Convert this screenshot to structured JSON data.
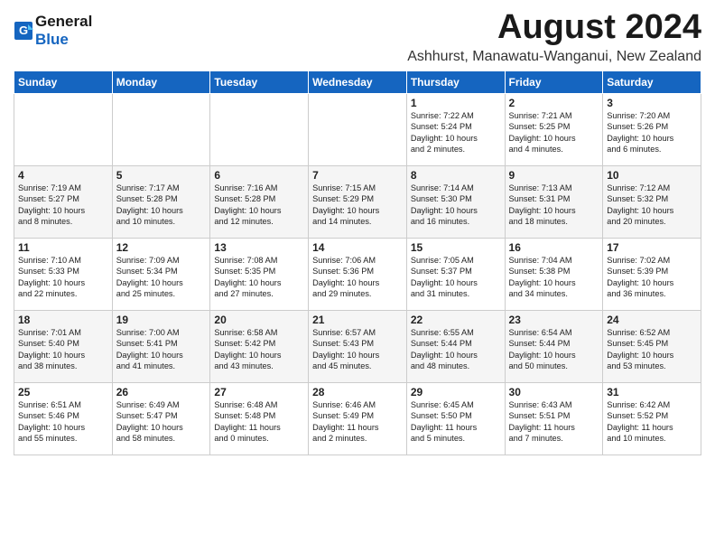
{
  "logo": {
    "general": "General",
    "blue": "Blue"
  },
  "title": "August 2024",
  "subtitle": "Ashhurst, Manawatu-Wanganui, New Zealand",
  "days_header": [
    "Sunday",
    "Monday",
    "Tuesday",
    "Wednesday",
    "Thursday",
    "Friday",
    "Saturday"
  ],
  "weeks": [
    [
      {
        "day": "",
        "info": ""
      },
      {
        "day": "",
        "info": ""
      },
      {
        "day": "",
        "info": ""
      },
      {
        "day": "",
        "info": ""
      },
      {
        "day": "1",
        "info": "Sunrise: 7:22 AM\nSunset: 5:24 PM\nDaylight: 10 hours\nand 2 minutes."
      },
      {
        "day": "2",
        "info": "Sunrise: 7:21 AM\nSunset: 5:25 PM\nDaylight: 10 hours\nand 4 minutes."
      },
      {
        "day": "3",
        "info": "Sunrise: 7:20 AM\nSunset: 5:26 PM\nDaylight: 10 hours\nand 6 minutes."
      }
    ],
    [
      {
        "day": "4",
        "info": "Sunrise: 7:19 AM\nSunset: 5:27 PM\nDaylight: 10 hours\nand 8 minutes."
      },
      {
        "day": "5",
        "info": "Sunrise: 7:17 AM\nSunset: 5:28 PM\nDaylight: 10 hours\nand 10 minutes."
      },
      {
        "day": "6",
        "info": "Sunrise: 7:16 AM\nSunset: 5:28 PM\nDaylight: 10 hours\nand 12 minutes."
      },
      {
        "day": "7",
        "info": "Sunrise: 7:15 AM\nSunset: 5:29 PM\nDaylight: 10 hours\nand 14 minutes."
      },
      {
        "day": "8",
        "info": "Sunrise: 7:14 AM\nSunset: 5:30 PM\nDaylight: 10 hours\nand 16 minutes."
      },
      {
        "day": "9",
        "info": "Sunrise: 7:13 AM\nSunset: 5:31 PM\nDaylight: 10 hours\nand 18 minutes."
      },
      {
        "day": "10",
        "info": "Sunrise: 7:12 AM\nSunset: 5:32 PM\nDaylight: 10 hours\nand 20 minutes."
      }
    ],
    [
      {
        "day": "11",
        "info": "Sunrise: 7:10 AM\nSunset: 5:33 PM\nDaylight: 10 hours\nand 22 minutes."
      },
      {
        "day": "12",
        "info": "Sunrise: 7:09 AM\nSunset: 5:34 PM\nDaylight: 10 hours\nand 25 minutes."
      },
      {
        "day": "13",
        "info": "Sunrise: 7:08 AM\nSunset: 5:35 PM\nDaylight: 10 hours\nand 27 minutes."
      },
      {
        "day": "14",
        "info": "Sunrise: 7:06 AM\nSunset: 5:36 PM\nDaylight: 10 hours\nand 29 minutes."
      },
      {
        "day": "15",
        "info": "Sunrise: 7:05 AM\nSunset: 5:37 PM\nDaylight: 10 hours\nand 31 minutes."
      },
      {
        "day": "16",
        "info": "Sunrise: 7:04 AM\nSunset: 5:38 PM\nDaylight: 10 hours\nand 34 minutes."
      },
      {
        "day": "17",
        "info": "Sunrise: 7:02 AM\nSunset: 5:39 PM\nDaylight: 10 hours\nand 36 minutes."
      }
    ],
    [
      {
        "day": "18",
        "info": "Sunrise: 7:01 AM\nSunset: 5:40 PM\nDaylight: 10 hours\nand 38 minutes."
      },
      {
        "day": "19",
        "info": "Sunrise: 7:00 AM\nSunset: 5:41 PM\nDaylight: 10 hours\nand 41 minutes."
      },
      {
        "day": "20",
        "info": "Sunrise: 6:58 AM\nSunset: 5:42 PM\nDaylight: 10 hours\nand 43 minutes."
      },
      {
        "day": "21",
        "info": "Sunrise: 6:57 AM\nSunset: 5:43 PM\nDaylight: 10 hours\nand 45 minutes."
      },
      {
        "day": "22",
        "info": "Sunrise: 6:55 AM\nSunset: 5:44 PM\nDaylight: 10 hours\nand 48 minutes."
      },
      {
        "day": "23",
        "info": "Sunrise: 6:54 AM\nSunset: 5:44 PM\nDaylight: 10 hours\nand 50 minutes."
      },
      {
        "day": "24",
        "info": "Sunrise: 6:52 AM\nSunset: 5:45 PM\nDaylight: 10 hours\nand 53 minutes."
      }
    ],
    [
      {
        "day": "25",
        "info": "Sunrise: 6:51 AM\nSunset: 5:46 PM\nDaylight: 10 hours\nand 55 minutes."
      },
      {
        "day": "26",
        "info": "Sunrise: 6:49 AM\nSunset: 5:47 PM\nDaylight: 10 hours\nand 58 minutes."
      },
      {
        "day": "27",
        "info": "Sunrise: 6:48 AM\nSunset: 5:48 PM\nDaylight: 11 hours\nand 0 minutes."
      },
      {
        "day": "28",
        "info": "Sunrise: 6:46 AM\nSunset: 5:49 PM\nDaylight: 11 hours\nand 2 minutes."
      },
      {
        "day": "29",
        "info": "Sunrise: 6:45 AM\nSunset: 5:50 PM\nDaylight: 11 hours\nand 5 minutes."
      },
      {
        "day": "30",
        "info": "Sunrise: 6:43 AM\nSunset: 5:51 PM\nDaylight: 11 hours\nand 7 minutes."
      },
      {
        "day": "31",
        "info": "Sunrise: 6:42 AM\nSunset: 5:52 PM\nDaylight: 11 hours\nand 10 minutes."
      }
    ]
  ]
}
